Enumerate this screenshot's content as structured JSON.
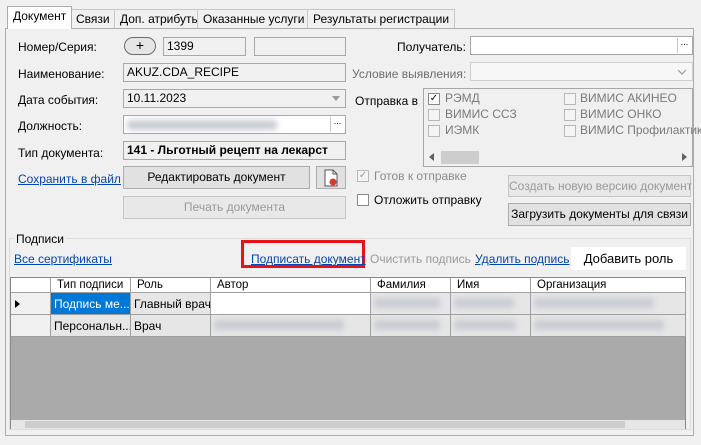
{
  "tabs": [
    {
      "label": "Документ"
    },
    {
      "label": "Связи"
    },
    {
      "label": "Доп. атрибуты"
    },
    {
      "label": "Оказанные услуги"
    },
    {
      "label": "Результаты регистрации"
    }
  ],
  "form": {
    "number_label": "Номер/Серия:",
    "plus_button": "+",
    "number_value": "1399",
    "series_value": "",
    "name_label": "Наименование:",
    "name_value": "AKUZ.CDA_RECIPE",
    "event_date_label": "Дата события:",
    "event_date_value": "10.11.2023",
    "position_label": "Должность:",
    "doc_type_label": "Тип документа:",
    "doc_type_value": "141 - Льготный рецепт на лекарст",
    "save_to_file": "Сохранить в файл",
    "edit_document": "Редактировать документ",
    "print_document": "Печать документа",
    "recipient_label": "Получатель:",
    "recipient_value": "",
    "detection_label": "Условие выявления:",
    "detection_value": "",
    "send_to_label": "Отправка в",
    "ready_to_send": "Готов к отправке",
    "postpone_send": "Отложить отправку",
    "create_new_version": "Создать новую версию документ",
    "upload_documents": "Загрузить документы для связи",
    "ellipsis": "..."
  },
  "send_targets": [
    {
      "label": "РЭМД",
      "checked": true
    },
    {
      "label": "ВИМИС АКИНЕО",
      "checked": false
    },
    {
      "label": "ВИМИС ССЗ",
      "checked": false
    },
    {
      "label": "ВИМИС ОНКО",
      "checked": false
    },
    {
      "label": "ИЭМК",
      "checked": false
    },
    {
      "label": "ВИМИС Профилактик",
      "checked": false
    }
  ],
  "signatures": {
    "group_label": "Подписи",
    "all_certificates": "Все сертификаты",
    "sign_document": "Подписать документ",
    "clear_signature": "Очистить подпись",
    "delete_signature": "Удалить подпись",
    "add_role": "Добавить роль",
    "columns": [
      "Тип подписи",
      "Роль",
      "Автор",
      "Фамилия",
      "Имя",
      "Организация"
    ],
    "rows": [
      {
        "type": "Подпись ме...",
        "role": "Главный врач"
      },
      {
        "type": "Персональн...",
        "role": "Врач"
      }
    ]
  },
  "colors": {
    "highlight_border": "#e8101a",
    "link": "#0645ad",
    "selection": "#0078d7"
  }
}
